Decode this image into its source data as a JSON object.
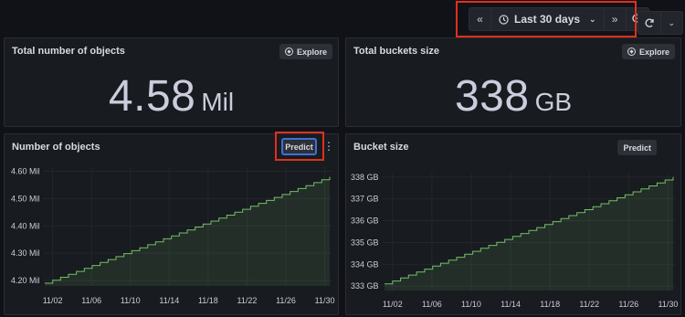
{
  "toolbar": {
    "zoom_back_icon": "double-chevron-left-icon",
    "time_range_label": "Last 30 days",
    "clock_icon": "clock-icon",
    "chevron_icon": "chevron-down-icon",
    "zoom_forward_icon": "double-chevron-right-icon",
    "zoom_out_icon": "zoom-out-icon",
    "refresh_icon": "refresh-icon",
    "refresh_menu_icon": "chevron-down-icon"
  },
  "panels": {
    "total_objects": {
      "title": "Total number of objects",
      "explore_label": "Explore",
      "value": "4.58",
      "unit": "Mil"
    },
    "total_buckets": {
      "title": "Total buckets size",
      "explore_label": "Explore",
      "value": "338",
      "unit": "GB"
    },
    "num_objects": {
      "title": "Number of objects",
      "predict_label": "Predict",
      "menu_icon": "kebab-menu-icon"
    },
    "bucket_size": {
      "title": "Bucket size",
      "predict_label": "Predict"
    }
  },
  "colors": {
    "background": "#111217",
    "panel": "#181b1f",
    "series_line": "#73bf69",
    "highlight": "#e0301e",
    "active_border": "#3d71d9"
  },
  "chart_data": [
    {
      "type": "line",
      "title": "Number of objects",
      "ylabel": "",
      "yticks": [
        "4.20 Mil",
        "4.30 Mil",
        "4.40 Mil",
        "4.50 Mil",
        "4.60 Mil"
      ],
      "ylim": [
        4.18,
        4.615
      ],
      "xticks": [
        "11/02",
        "11/06",
        "11/10",
        "11/14",
        "11/18",
        "11/22",
        "11/26",
        "11/30"
      ],
      "x": [
        "11/01",
        "11/30"
      ],
      "series": [
        {
          "values": [
            4.19,
            4.58
          ],
          "shape": "step"
        }
      ],
      "fill": true,
      "grid": true
    },
    {
      "type": "line",
      "title": "Bucket size",
      "ylabel": "",
      "yticks": [
        "333 GB",
        "334 GB",
        "335 GB",
        "336 GB",
        "337 GB",
        "338 GB"
      ],
      "ylim": [
        332.8,
        338.2
      ],
      "xticks": [
        "11/02",
        "11/06",
        "11/10",
        "11/14",
        "11/18",
        "11/22",
        "11/26",
        "11/30"
      ],
      "x": [
        "11/01",
        "11/30"
      ],
      "series": [
        {
          "values": [
            333.1,
            338.0
          ],
          "shape": "step"
        }
      ],
      "fill": true,
      "grid": true
    }
  ]
}
